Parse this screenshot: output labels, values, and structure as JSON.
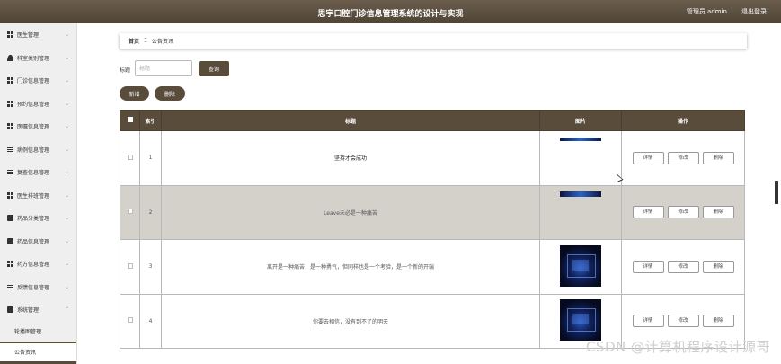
{
  "header": {
    "title": "思宇口腔门诊信息管理系统的设计与实现",
    "user": "管理员 admin",
    "logout": "退出登录"
  },
  "sidebar": {
    "items": [
      {
        "label": "医生管理",
        "icon": "grid-icon"
      },
      {
        "label": "科室类别管理",
        "icon": "person-icon"
      },
      {
        "label": "门诊信息管理",
        "icon": "grid-icon"
      },
      {
        "label": "预约信息管理",
        "icon": "grid-icon"
      },
      {
        "label": "医嘱信息管理",
        "icon": "grid-icon"
      },
      {
        "label": "病例信息管理",
        "icon": "list-icon"
      },
      {
        "label": "复查信息管理",
        "icon": "list-icon"
      },
      {
        "label": "医生排班管理",
        "icon": "grid-icon"
      },
      {
        "label": "药品分类管理",
        "icon": "square-icon"
      },
      {
        "label": "药品信息管理",
        "icon": "square-icon"
      },
      {
        "label": "药方信息管理",
        "icon": "grid-icon"
      },
      {
        "label": "反馈信息管理",
        "icon": "chart-icon"
      },
      {
        "label": "系统管理",
        "icon": "square-icon"
      }
    ],
    "sub_items": [
      {
        "label": "轮播图管理"
      },
      {
        "label": "公告资讯"
      }
    ]
  },
  "breadcrumb": {
    "home": "首页",
    "separator": "Ξ",
    "current": "公告资讯"
  },
  "search": {
    "label": "标题",
    "placeholder": "标题",
    "query_button": "查询"
  },
  "actions": {
    "add": "新增",
    "delete": "删除"
  },
  "table": {
    "columns": [
      "索引",
      "标题",
      "图片",
      "操作"
    ],
    "operations": [
      "详情",
      "修改",
      "删除"
    ],
    "rows": [
      {
        "index": "1",
        "title": "坚持才会成功",
        "image": "strip"
      },
      {
        "index": "2",
        "title": "Leave未必是一种痛苦",
        "image": "strip"
      },
      {
        "index": "3",
        "title": "离开是一种痛苦，是一种勇气，但同样也是一个考验，是一个新的开端",
        "image": "full"
      },
      {
        "index": "4",
        "title": "你要去相信，没有到不了的明天",
        "image": "full"
      }
    ]
  },
  "watermark": "CSDN @计算机程序设计源哥",
  "colors": {
    "accent": "#5a4c3b",
    "topbar": "#5e5141",
    "row_shade": "#d4d1cb"
  }
}
